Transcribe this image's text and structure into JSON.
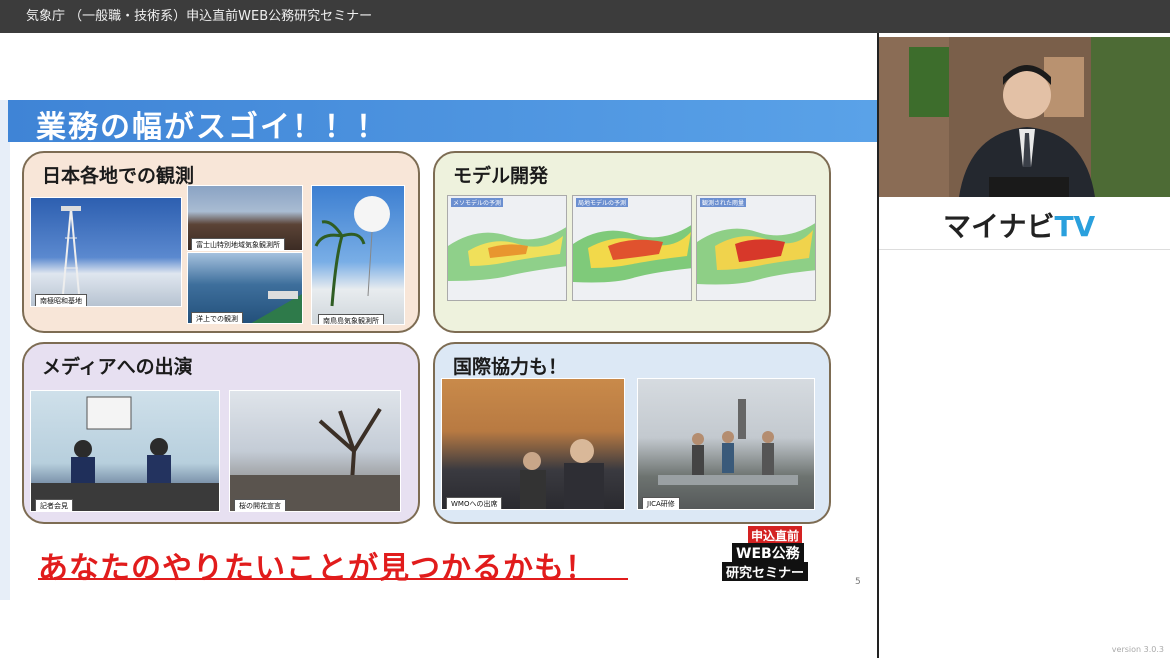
{
  "window": {
    "title": "気象庁 （一般職・技術系）申込直前WEB公務研究セミナー"
  },
  "slide": {
    "heading": "業務の幅がスゴイ！！！",
    "panels": [
      {
        "title": "日本各地での観測",
        "captions": [
          "南極昭和基地",
          "富士山特別地域気象観測所",
          "洋上での観測",
          "南鳥島気象観測所"
        ]
      },
      {
        "title": "モデル開発",
        "captions": [
          "メソモデルの予測",
          "局地モデルの予測",
          "観測された雨量"
        ]
      },
      {
        "title": "メディアへの出演",
        "captions": [
          "記者会見",
          "桜の開花宣言"
        ]
      },
      {
        "title": "国際協力も！",
        "captions": [
          "WMOへの出席",
          "JICA研修"
        ]
      }
    ],
    "tagline": "あなたのやりたいことが見つかるかも！",
    "badge": {
      "line1": "申込直前",
      "line2": "WEB公務",
      "line3": "研究セミナー"
    },
    "page_number": "5"
  },
  "sidebar": {
    "logo_main": "マイナビ",
    "logo_tv": "TV",
    "version": "version 3.0.3"
  },
  "colors": {
    "banner": "#4a90e2",
    "accent_red": "#e11c1c",
    "logo_blue": "#2aa0dd"
  }
}
